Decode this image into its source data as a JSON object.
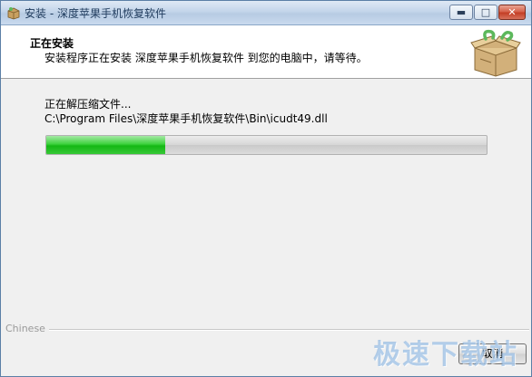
{
  "window": {
    "title": "安装 - 深度苹果手机恢复软件",
    "controls": {
      "minimize_icon": "minimize-icon",
      "maximize_icon": "maximize-icon",
      "close_icon": "close-icon"
    }
  },
  "header": {
    "title": "正在安装",
    "subtitle": "安装程序正在安装 深度苹果手机恢复软件 到您的电脑中，请等待。",
    "logo_icon": "package-box-icon"
  },
  "main": {
    "status": "正在解压缩文件...",
    "current_file": "C:\\Program Files\\深度苹果手机恢复软件\\Bin\\icudt49.dll",
    "progress": 0.27
  },
  "footer": {
    "brand": "Chinese",
    "cancel_label": "取消"
  },
  "watermark": "极速下载站",
  "colors": {
    "progress_fill": "#1cbd1c",
    "title_bar": "#c3d5ea"
  }
}
